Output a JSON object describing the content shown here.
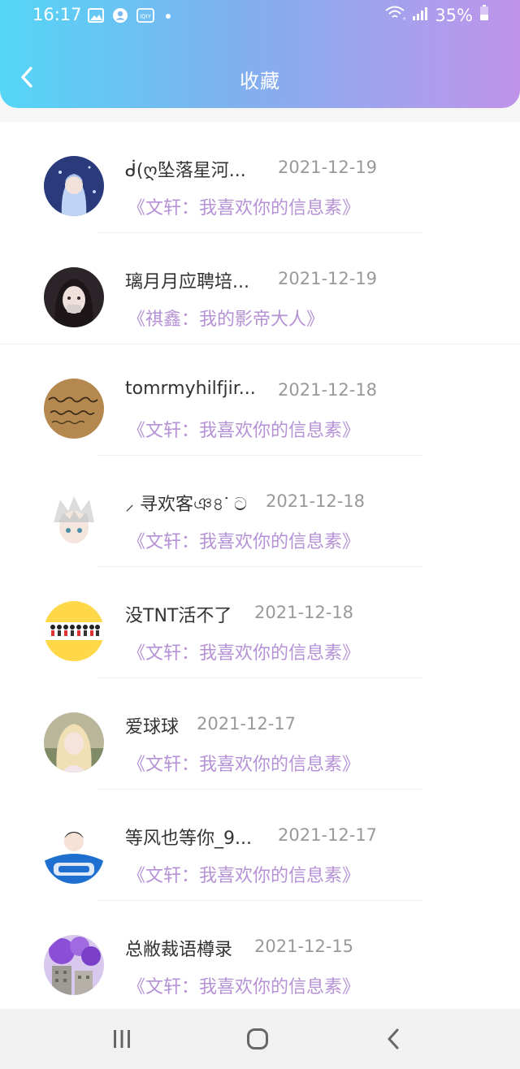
{
  "status_bar": {
    "time": "16:17",
    "left_icons": [
      "gallery-icon",
      "account-icon",
      "iqiyi-icon",
      "dot-icon"
    ],
    "battery": "35%"
  },
  "header": {
    "title": "收藏",
    "back_icon": "chevron-left-icon"
  },
  "items": [
    {
      "name": "ᑰ(ღ坠落星河...",
      "date": "2021-12-19",
      "title": "《文轩：我喜欢你的信息素》"
    },
    {
      "name": "璃月月应聘培...",
      "date": "2021-12-19",
      "title": "《祺鑫：我的影帝大人》"
    },
    {
      "name": "tomrmyhilfjir...",
      "date": "2021-12-18",
      "title": "《文轩：我喜欢你的信息素》"
    },
    {
      "name": "⸝ 寻欢客ঞ৪ᐝ ට",
      "date": "2021-12-18",
      "title": "《文轩：我喜欢你的信息素》"
    },
    {
      "name": "没TNT活不了",
      "date": "2021-12-18",
      "title": "《文轩：我喜欢你的信息素》"
    },
    {
      "name": "爱球球",
      "date": "2021-12-17",
      "title": "《文轩：我喜欢你的信息素》"
    },
    {
      "name": "等风也等你_9...",
      "date": "2021-12-17",
      "title": "《文轩：我喜欢你的信息素》"
    },
    {
      "name": "总敝裁语樽录",
      "date": "2021-12-15",
      "title": "《文轩：我喜欢你的信息素》"
    }
  ],
  "colors": {
    "header_gradient_start": "#54d6f6",
    "header_gradient_end": "#bf93ea",
    "collection_title": "#b591d6",
    "date": "#999999",
    "name": "#333333"
  },
  "nav_bar": {
    "icons": [
      "recent-apps-icon",
      "home-icon",
      "back-icon"
    ]
  }
}
